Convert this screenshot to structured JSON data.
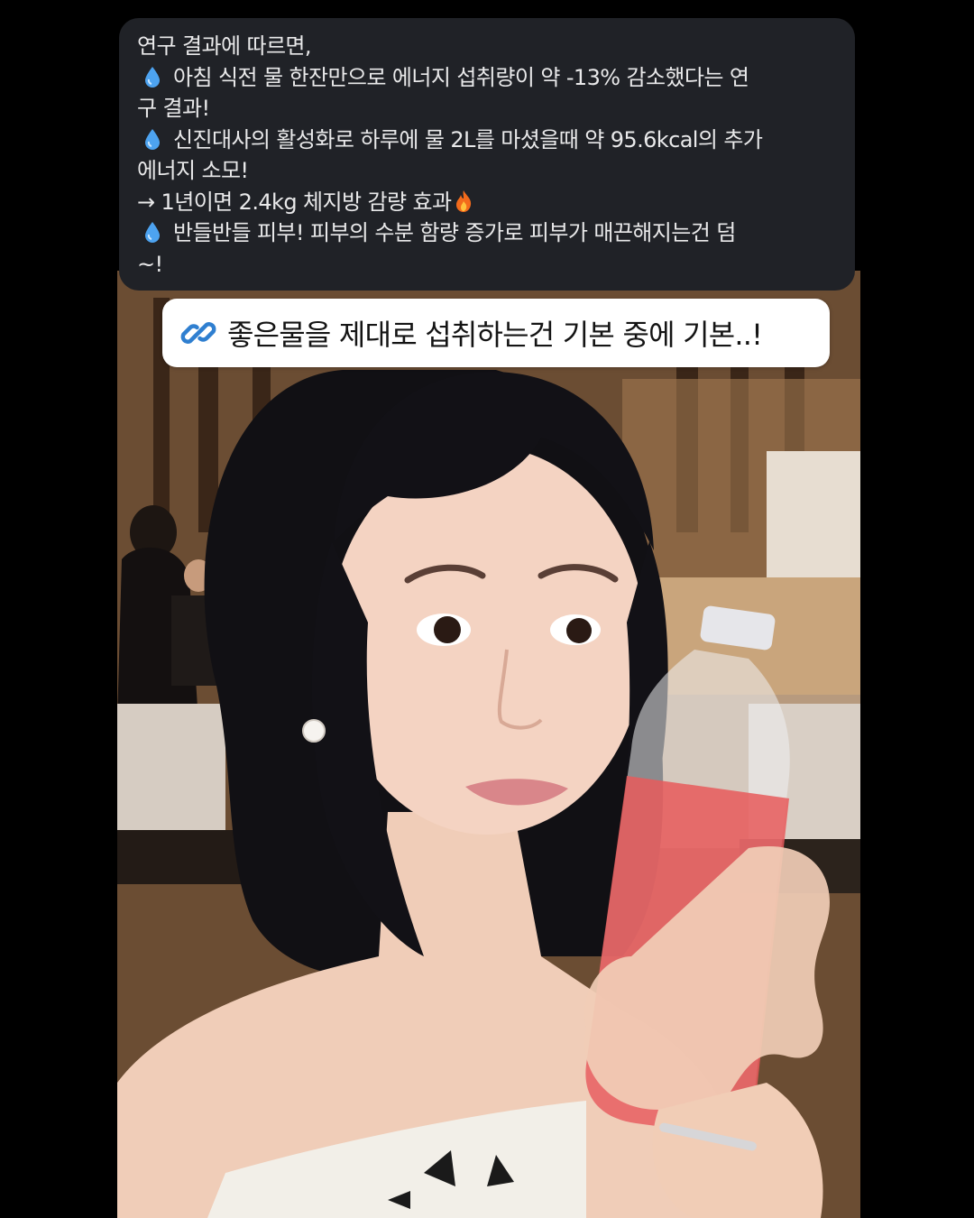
{
  "post_text": {
    "lines": [
      "연구 결과에 따르면,",
      "아침 식전 물 한잔만으로 에너지 섭취량이 약 -13% 감소했다는 연",
      "구 결과!",
      "신진대사의 활성화로 하루에 물 2L를 마셨을때 약 95.6kcal의 추가",
      "에너지 소모!",
      "→ 1년이면 2.4kg 체지방 감량 효과",
      "반들반들 피부! 피부의 수분 함량 증가로 피부가 매끈해지는건 덤",
      "~!"
    ],
    "icons": {
      "drop": "water-drop-icon",
      "fire": "fire-icon"
    }
  },
  "link_sticker": {
    "text": "좋은물을 제대로 섭취하는건 기본 중에 기본..!",
    "icon": "link-icon"
  },
  "colors": {
    "background": "#000000",
    "card": "#202227",
    "card_text": "#e9e9ea",
    "sticker_bg": "#ffffff",
    "link_icon": "#2f7fd0"
  }
}
